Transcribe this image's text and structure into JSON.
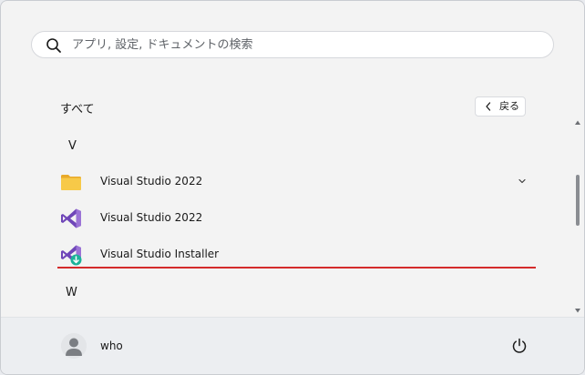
{
  "search": {
    "placeholder": "アプリ, 設定, ドキュメントの検索",
    "icon": "search-icon"
  },
  "all_apps": {
    "title": "すべて",
    "back_label": "戻る"
  },
  "groups": [
    {
      "letter": "V",
      "items": [
        {
          "label": "Visual Studio 2022",
          "icon": "folder-icon",
          "expandable": true
        },
        {
          "label": "Visual Studio 2022",
          "icon": "visual-studio-icon"
        },
        {
          "label": "Visual Studio Installer",
          "icon": "visual-studio-installer-icon"
        }
      ]
    },
    {
      "letter": "W",
      "items": []
    }
  ],
  "user": {
    "name": "who",
    "avatar_icon": "user-avatar-icon"
  },
  "power": {
    "icon": "power-icon"
  },
  "colors": {
    "accent_underline": "#d42b2b",
    "vs_purple": "#865fc5",
    "folder_yellow": "#f5c33b",
    "installer_badge": "#1db39a"
  }
}
